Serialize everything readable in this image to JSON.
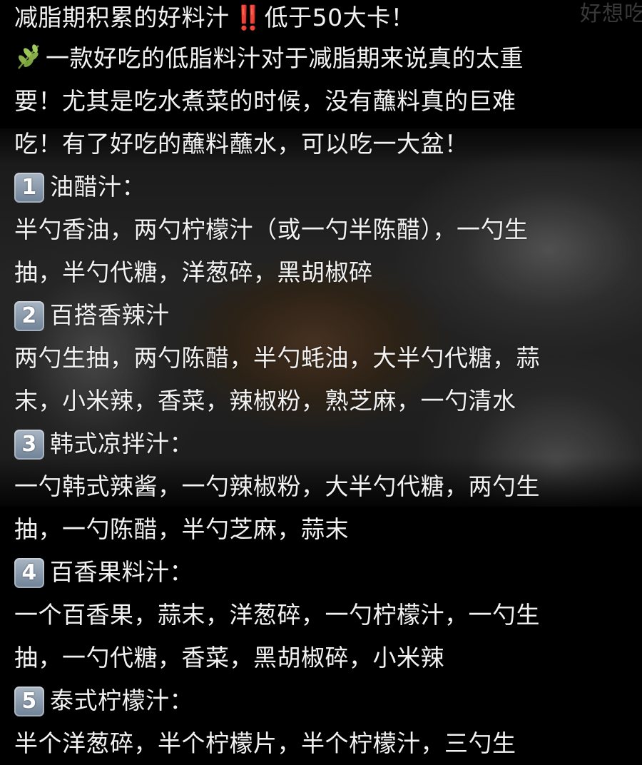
{
  "watermark": "好想吃",
  "title": {
    "text": "减脂期积累的好料汁",
    "emphasis": "‼️",
    "suffix": "低于50大卡！"
  },
  "intro": {
    "icon": "herb-leaf-icon",
    "lines": [
      "一款好吃的低脂料汁对于减脂期来说真的太重",
      "要！尤其是吃水煮菜的时候，没有蘸料真的巨难",
      "吃！有了好吃的蘸料蘸水，可以吃一大盆！"
    ]
  },
  "recipes": [
    {
      "badge": "1",
      "name": "油醋汁：",
      "lines": [
        "半勺香油，两勺柠檬汁（或一勺半陈醋），一勺生",
        "抽，半勺代糖，洋葱碎，黑胡椒碎"
      ]
    },
    {
      "badge": "2",
      "name": "百搭香辣汁",
      "lines": [
        "两勺生抽，两勺陈醋，半勺蚝油，大半勺代糖，蒜",
        "末，小米辣，香菜，辣椒粉，熟芝麻，一勺清水"
      ]
    },
    {
      "badge": "3",
      "name": "韩式凉拌汁：",
      "lines": [
        "一勺韩式辣酱，一勺辣椒粉，大半勺代糖，两勺生",
        "抽，一勺陈醋，半勺芝麻，蒜末"
      ]
    },
    {
      "badge": "4",
      "name": "百香果料汁：",
      "lines": [
        "一个百香果，蒜末，洋葱碎，一勺柠檬汁，一勺生",
        "抽，一勺代糖，香菜，黑胡椒碎，小米辣"
      ]
    },
    {
      "badge": "5",
      "name": "泰式柠檬汁：",
      "lines": [
        "半个洋葱碎，半个柠檬片，半个柠檬汁，三勺生"
      ]
    }
  ],
  "colors": {
    "background": "#000000",
    "text": "#f2f2f2",
    "emphasis": "#e53935",
    "badge": "#8a9bb0"
  }
}
